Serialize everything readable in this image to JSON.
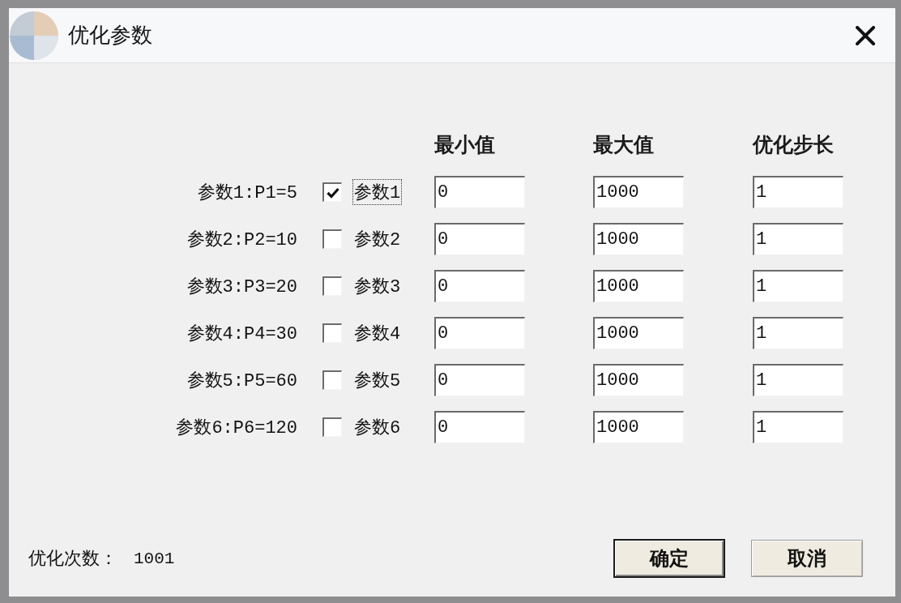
{
  "window": {
    "title": "优化参数"
  },
  "columns": [
    "最小值",
    "最大值",
    "优化步长"
  ],
  "parameters": [
    {
      "label": "参数1:P1=5",
      "checkbox_label": "参数1",
      "checked": true,
      "focused": true,
      "min": "0",
      "max": "1000",
      "step": "1"
    },
    {
      "label": "参数2:P2=10",
      "checkbox_label": "参数2",
      "checked": false,
      "focused": false,
      "min": "0",
      "max": "1000",
      "step": "1"
    },
    {
      "label": "参数3:P3=20",
      "checkbox_label": "参数3",
      "checked": false,
      "focused": false,
      "min": "0",
      "max": "1000",
      "step": "1"
    },
    {
      "label": "参数4:P4=30",
      "checkbox_label": "参数4",
      "checked": false,
      "focused": false,
      "min": "0",
      "max": "1000",
      "step": "1"
    },
    {
      "label": "参数5:P5=60",
      "checkbox_label": "参数5",
      "checked": false,
      "focused": false,
      "min": "0",
      "max": "1000",
      "step": "1"
    },
    {
      "label": "参数6:P6=120",
      "checkbox_label": "参数6",
      "checked": false,
      "focused": false,
      "min": "0",
      "max": "1000",
      "step": "1"
    }
  ],
  "summary": {
    "label": "优化次数：",
    "value": "1001"
  },
  "buttons": [
    {
      "label": "确定",
      "default": true
    },
    {
      "label": "取消",
      "default": false
    }
  ]
}
